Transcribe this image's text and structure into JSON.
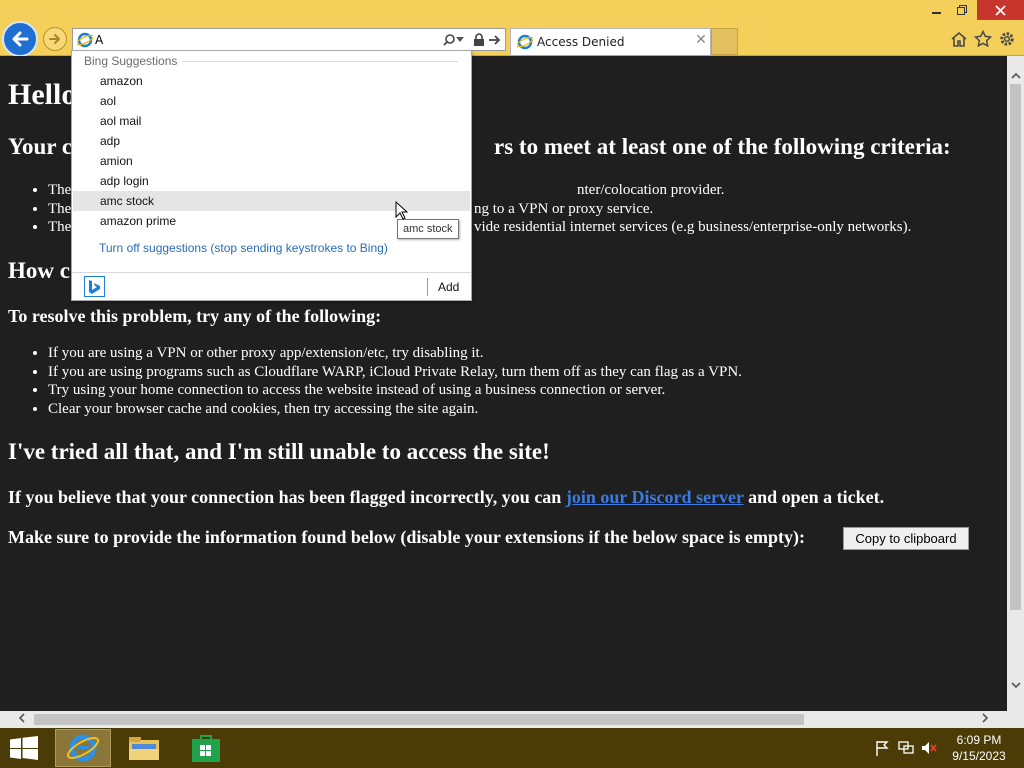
{
  "colors": {
    "chrome_bg": "#f4cf5a",
    "page_bg": "#1f1f1f",
    "link": "#3b7ae0",
    "taskbar_bg": "#4a3b07",
    "back_button": "#1f6fd2"
  },
  "browser": {
    "address_value": "A",
    "tab_title": "Access Denied"
  },
  "page": {
    "heading_partial": "Hello",
    "criteria_heading_start": "Your c",
    "criteria_heading_end": "rs to meet at least one of the following criteria:",
    "criteria_items": [
      {
        "start": "The",
        "end": "nter/colocation provider."
      },
      {
        "start": "The",
        "end": "ng to a VPN or proxy service."
      },
      {
        "start": "The",
        "end": "vide residential internet services (e.g business/enterprise-only networks)."
      }
    ],
    "how_heading_partial": "How c",
    "resolve_heading": "To resolve this problem, try any of the following:",
    "resolve_items": [
      "If you are using a VPN or other proxy app/extension/etc, try disabling it.",
      "If you are using programs such as Cloudflare WARP, iCloud Private Relay, turn them off as they can flag as a VPN.",
      "Try using your home connection to access the website instead of using a business connection or server.",
      "Clear your browser cache and cookies, then try accessing the site again."
    ],
    "tried_heading": "I've tried all that, and I'm still unable to access the site!",
    "flagged_before": "If you believe that your connection has been flagged incorrectly, you can",
    "discord_link": "join our Discord server",
    "flagged_after": "and open a ticket.",
    "provide_text": "Make sure to provide the information found below (disable your extensions if the below space is empty):",
    "copy_button": "Copy to clipboard"
  },
  "suggestions": {
    "header": "Bing Suggestions",
    "items": [
      "amazon",
      "aol",
      "aol mail",
      "adp",
      "amion",
      "adp login",
      "amc stock",
      "amazon prime"
    ],
    "hovered_index": 6,
    "turn_off": "Turn off suggestions (stop sending keystrokes to Bing)",
    "add_label": "Add",
    "tooltip": "amc stock"
  },
  "taskbar": {
    "time": "6:09 PM",
    "date": "9/15/2023"
  }
}
